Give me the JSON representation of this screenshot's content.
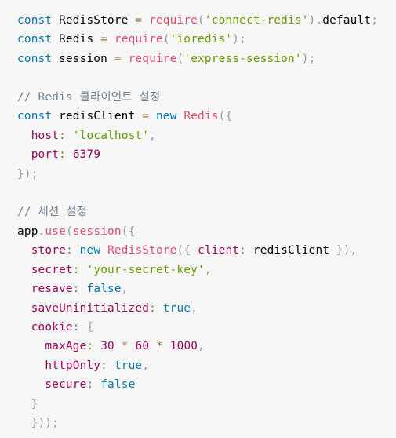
{
  "code": {
    "language": "javascript",
    "colors": {
      "background": "#f7f7f7",
      "keyword": "#0077aa",
      "function": "#dd4a68",
      "string": "#669900",
      "property": "#990055",
      "number": "#990055",
      "operator": "#9a6e3a",
      "punctuation": "#999999",
      "comment": "#708090",
      "plain": "#000000"
    },
    "lines": [
      [
        [
          "kw",
          "const"
        ],
        [
          "plain",
          " RedisStore "
        ],
        [
          "op",
          "="
        ],
        [
          "plain",
          " "
        ],
        [
          "fn",
          "require"
        ],
        [
          "punc",
          "("
        ],
        [
          "str",
          "'connect-redis'"
        ],
        [
          "punc",
          ")"
        ],
        [
          "punc",
          "."
        ],
        [
          "plain",
          "default"
        ],
        [
          "punc",
          ";"
        ]
      ],
      [
        [
          "kw",
          "const"
        ],
        [
          "plain",
          " Redis "
        ],
        [
          "op",
          "="
        ],
        [
          "plain",
          " "
        ],
        [
          "fn",
          "require"
        ],
        [
          "punc",
          "("
        ],
        [
          "str",
          "'ioredis'"
        ],
        [
          "punc",
          ")"
        ],
        [
          "punc",
          ";"
        ]
      ],
      [
        [
          "kw",
          "const"
        ],
        [
          "plain",
          " session "
        ],
        [
          "op",
          "="
        ],
        [
          "plain",
          " "
        ],
        [
          "fn",
          "require"
        ],
        [
          "punc",
          "("
        ],
        [
          "str",
          "'express-session'"
        ],
        [
          "punc",
          ")"
        ],
        [
          "punc",
          ";"
        ]
      ],
      [],
      [
        [
          "com",
          "// Redis 클라이언트 설정"
        ]
      ],
      [
        [
          "kw",
          "const"
        ],
        [
          "plain",
          " redisClient "
        ],
        [
          "op",
          "="
        ],
        [
          "plain",
          " "
        ],
        [
          "kw",
          "new"
        ],
        [
          "plain",
          " "
        ],
        [
          "fn",
          "Redis"
        ],
        [
          "punc",
          "("
        ],
        [
          "punc",
          "{"
        ]
      ],
      [
        [
          "plain",
          "  "
        ],
        [
          "prop",
          "host"
        ],
        [
          "op",
          ":"
        ],
        [
          "plain",
          " "
        ],
        [
          "str",
          "'localhost'"
        ],
        [
          "punc",
          ","
        ]
      ],
      [
        [
          "plain",
          "  "
        ],
        [
          "prop",
          "port"
        ],
        [
          "op",
          ":"
        ],
        [
          "plain",
          " "
        ],
        [
          "num",
          "6379"
        ]
      ],
      [
        [
          "punc",
          "}"
        ],
        [
          "punc",
          ")"
        ],
        [
          "punc",
          ";"
        ]
      ],
      [],
      [
        [
          "com",
          "// 세션 설정"
        ]
      ],
      [
        [
          "plain",
          "app"
        ],
        [
          "punc",
          "."
        ],
        [
          "fn",
          "use"
        ],
        [
          "punc",
          "("
        ],
        [
          "fn",
          "session"
        ],
        [
          "punc",
          "("
        ],
        [
          "punc",
          "{"
        ]
      ],
      [
        [
          "plain",
          "  "
        ],
        [
          "prop",
          "store"
        ],
        [
          "op",
          ":"
        ],
        [
          "plain",
          " "
        ],
        [
          "kw",
          "new"
        ],
        [
          "plain",
          " "
        ],
        [
          "fn",
          "RedisStore"
        ],
        [
          "punc",
          "("
        ],
        [
          "punc",
          "{"
        ],
        [
          "plain",
          " "
        ],
        [
          "prop",
          "client"
        ],
        [
          "op",
          ":"
        ],
        [
          "plain",
          " redisClient "
        ],
        [
          "punc",
          "}"
        ],
        [
          "punc",
          ")"
        ],
        [
          "punc",
          ","
        ]
      ],
      [
        [
          "plain",
          "  "
        ],
        [
          "prop",
          "secret"
        ],
        [
          "op",
          ":"
        ],
        [
          "plain",
          " "
        ],
        [
          "str",
          "'your-secret-key'"
        ],
        [
          "punc",
          ","
        ]
      ],
      [
        [
          "plain",
          "  "
        ],
        [
          "prop",
          "resave"
        ],
        [
          "op",
          ":"
        ],
        [
          "plain",
          " "
        ],
        [
          "kw",
          "false"
        ],
        [
          "punc",
          ","
        ]
      ],
      [
        [
          "plain",
          "  "
        ],
        [
          "prop",
          "saveUninitialized"
        ],
        [
          "op",
          ":"
        ],
        [
          "plain",
          " "
        ],
        [
          "kw",
          "true"
        ],
        [
          "punc",
          ","
        ]
      ],
      [
        [
          "plain",
          "  "
        ],
        [
          "prop",
          "cookie"
        ],
        [
          "op",
          ":"
        ],
        [
          "plain",
          " "
        ],
        [
          "punc",
          "{"
        ]
      ],
      [
        [
          "plain",
          "    "
        ],
        [
          "prop",
          "maxAge"
        ],
        [
          "op",
          ":"
        ],
        [
          "plain",
          " "
        ],
        [
          "num",
          "30"
        ],
        [
          "plain",
          " "
        ],
        [
          "op",
          "*"
        ],
        [
          "plain",
          " "
        ],
        [
          "num",
          "60"
        ],
        [
          "plain",
          " "
        ],
        [
          "op",
          "*"
        ],
        [
          "plain",
          " "
        ],
        [
          "num",
          "1000"
        ],
        [
          "punc",
          ","
        ]
      ],
      [
        [
          "plain",
          "    "
        ],
        [
          "prop",
          "httpOnly"
        ],
        [
          "op",
          ":"
        ],
        [
          "plain",
          " "
        ],
        [
          "kw",
          "true"
        ],
        [
          "punc",
          ","
        ]
      ],
      [
        [
          "plain",
          "    "
        ],
        [
          "prop",
          "secure"
        ],
        [
          "op",
          ":"
        ],
        [
          "plain",
          " "
        ],
        [
          "kw",
          "false"
        ]
      ],
      [
        [
          "plain",
          "  "
        ],
        [
          "punc",
          "}"
        ]
      ],
      [
        [
          "plain",
          "  "
        ],
        [
          "punc",
          "}"
        ],
        [
          "punc",
          ")"
        ],
        [
          "punc",
          ")"
        ],
        [
          "punc",
          ";"
        ]
      ]
    ]
  }
}
